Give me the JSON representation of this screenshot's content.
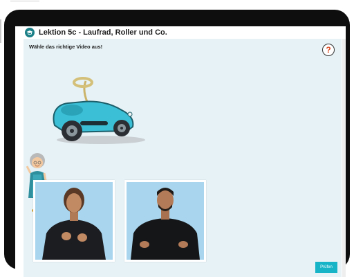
{
  "window": {
    "title": "Lektion 5c - Laufrad, Roller und Co.",
    "title_icon": "mortarboard-icon"
  },
  "exercise": {
    "instruction": "Wähle das richtige Video aus!",
    "help_label": "?",
    "check_label": "Prüfen",
    "options": [
      {
        "type": "sign-language-video"
      },
      {
        "type": "sign-language-video"
      }
    ]
  },
  "colors": {
    "accent": "#17b4c8",
    "title_icon_bg": "#1a7f86",
    "content_bg": "#e6f2f6",
    "help_question": "#d8451c",
    "video_bg": "#a9d6ee"
  },
  "icons": [
    "mortarboard-icon",
    "help-icon",
    "bobby-car-illustration",
    "grandmother-illustration"
  ]
}
